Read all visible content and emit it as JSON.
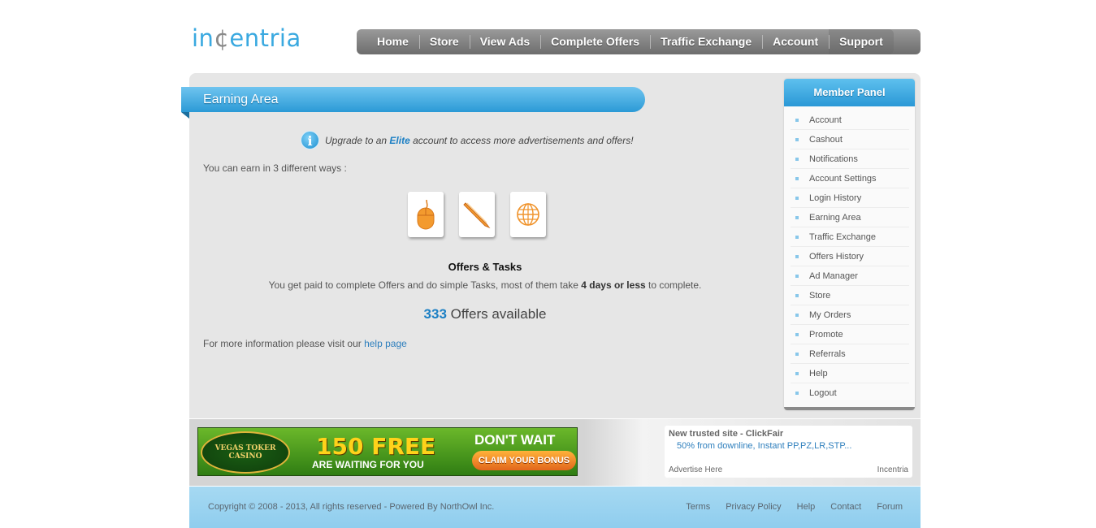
{
  "logo": {
    "prefix": "in",
    "cent": "¢",
    "suffix": "entria"
  },
  "nav": [
    "Home",
    "Store",
    "View Ads",
    "Complete Offers",
    "Traffic Exchange",
    "Account",
    "Support"
  ],
  "section_title": "Earning Area",
  "notice": {
    "before": "Upgrade to an ",
    "highlight": "Elite",
    "after": " account to access more advertisements and offers!"
  },
  "earn_intro": "You can earn in 3 different ways :",
  "tiles": [
    {
      "icon": "mouse-icon"
    },
    {
      "icon": "pen-icon"
    },
    {
      "icon": "globe-icon"
    }
  ],
  "offers": {
    "title": "Offers & Tasks",
    "desc_before": "You get paid to complete Offers and do simple Tasks, most of them take ",
    "desc_bold": "4 days or less",
    "desc_after": " to complete.",
    "count": "333",
    "count_label": " Offers available"
  },
  "more_info": {
    "text": "For more information please visit our ",
    "link": "help page"
  },
  "panel": {
    "title": "Member Panel",
    "items": [
      "Account",
      "Cashout",
      "Notifications",
      "Account Settings",
      "Login History",
      "Earning Area",
      "Traffic Exchange",
      "Offers History",
      "Ad Manager",
      "Store",
      "My Orders",
      "Promote",
      "Referrals",
      "Help",
      "Logout"
    ]
  },
  "banner": {
    "logo_line1": "VEGAS TOKER",
    "logo_line2": "CASINO",
    "free": "150 FREE",
    "waiting": "ARE WAITING FOR YOU",
    "dont_wait": "DON'T WAIT",
    "claim": "CLAIM YOUR BONUS"
  },
  "text_ad": {
    "title": "New trusted site - ClickFair",
    "desc": "50% from downline, Instant PP,PZ,LR,STP...",
    "advertise": "Advertise Here",
    "brand": "Incentria"
  },
  "footer": {
    "copyright": "Copyright © 2008 - 2013, All rights reserved - Powered By NorthOwl Inc.",
    "links": [
      "Terms",
      "Privacy Policy",
      "Help",
      "Contact",
      "Forum"
    ]
  },
  "colors": {
    "accent": "#2b9ad6",
    "link": "#2e7fbd",
    "icon_orange": "#f0932b"
  }
}
